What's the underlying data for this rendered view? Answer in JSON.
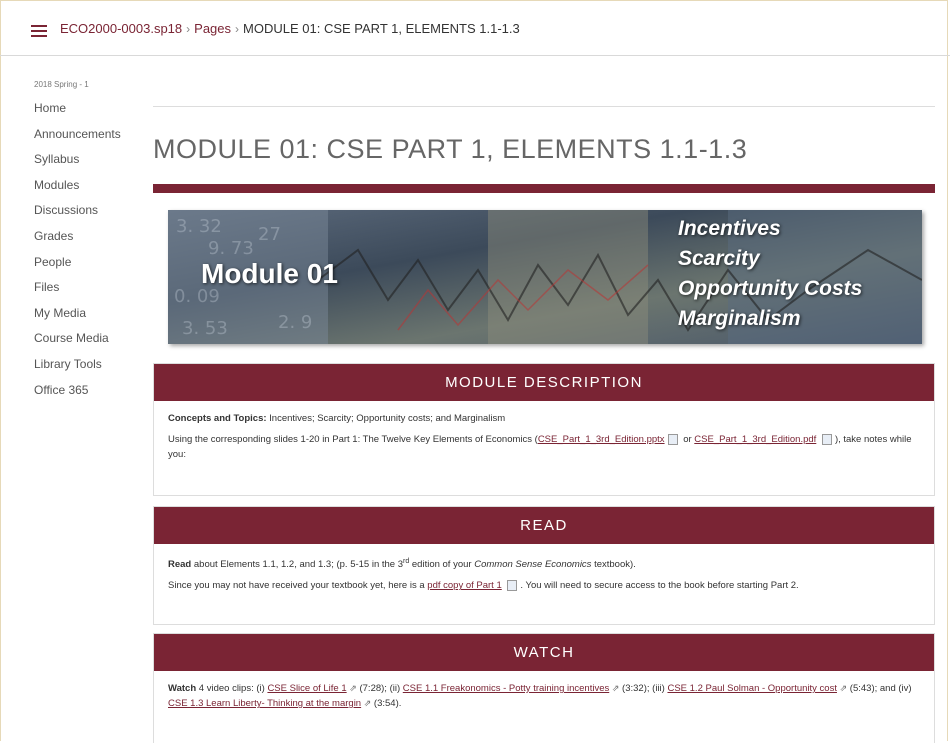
{
  "breadcrumb": {
    "course": "ECO2000-0003.sp18",
    "pages": "Pages",
    "current": "MODULE 01: CSE PART 1, ELEMENTS 1.1-1.3",
    "separator": "›"
  },
  "sidebar": {
    "term": "2018 Spring - 1",
    "items": [
      {
        "label": "Home"
      },
      {
        "label": "Announcements"
      },
      {
        "label": "Syllabus"
      },
      {
        "label": "Modules"
      },
      {
        "label": "Discussions"
      },
      {
        "label": "Grades"
      },
      {
        "label": "People"
      },
      {
        "label": "Files"
      },
      {
        "label": "My Media"
      },
      {
        "label": "Course Media"
      },
      {
        "label": "Library Tools"
      },
      {
        "label": "Office 365"
      }
    ]
  },
  "page": {
    "title": "MODULE 01: CSE PART 1, ELEMENTS 1.1-1.3",
    "accent_color": "#7a2434"
  },
  "banner": {
    "title": "Module 01",
    "keywords": [
      "Incentives",
      "Scarcity",
      "Opportunity Costs",
      "Marginalism"
    ]
  },
  "description": {
    "header": "MODULE DESCRIPTION",
    "concepts_label": "Concepts and Topics:",
    "concepts_text": " Incentives; Scarcity; Opportunity costs; and Marginalism",
    "slides_text": "Using the corresponding slides 1-20 in Part 1: The Twelve Key Elements of Economics (",
    "link_pptx": "CSE_Part_1_3rd_Edition.pptx",
    "or_text": " or ",
    "link_pdf": "CSE_Part_1_3rd_Edition.pdf",
    "end_text": "), take notes while you:"
  },
  "read": {
    "header": "READ",
    "read_label": "Read",
    "read_text": " about Elements 1.1, 1.2, and 1.3; (p. 5-15 in the 3",
    "sup": "rd",
    "read_text2": " edition of your ",
    "book": "Common Sense Economics",
    "read_text3": " textbook).",
    "since_text": "Since you may not have received your textbook yet, here is a ",
    "pdf_link": "pdf copy of Part 1",
    "since_text2": ".  You will need to secure access to the book before starting Part 2."
  },
  "watch": {
    "header": "WATCH",
    "watch_label": "Watch",
    "intro": " 4 video clips: (i) ",
    "clip1": "CSE Slice of Life 1",
    "t1": " (7:28); (ii) ",
    "clip2": "CSE 1.1 Freakonomics - Potty training incentives",
    "t2": " (3:32); (iii) ",
    "clip3": "CSE 1.2 Paul Solman - Opportunity cost",
    "t3": " (5:43); and (iv) ",
    "clip4": "CSE 1.3 Learn Liberty- Thinking at the margin",
    "t4": " (3:54)."
  }
}
